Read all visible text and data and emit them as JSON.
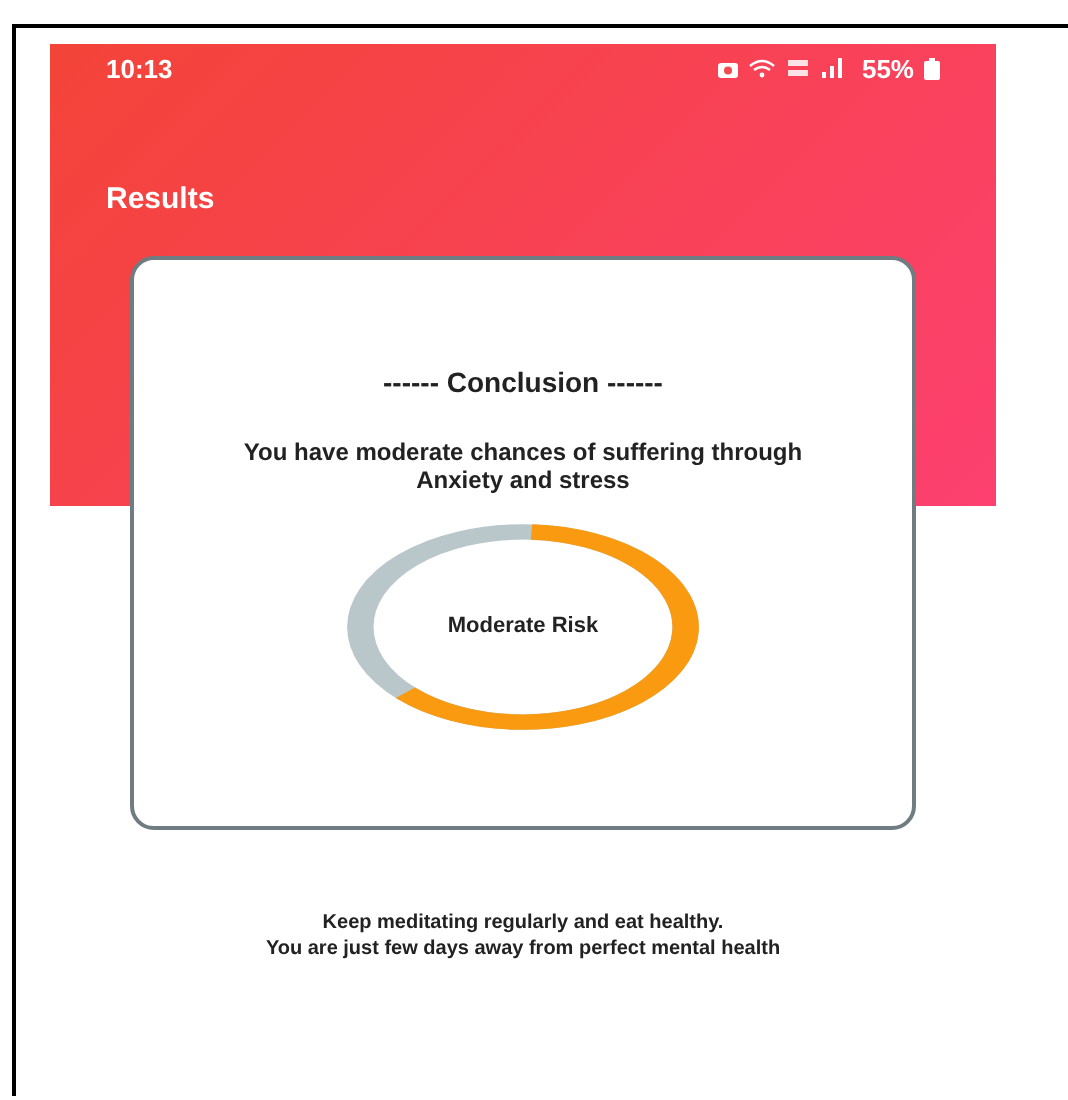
{
  "status_bar": {
    "time": "10:13",
    "battery": "55%"
  },
  "header": {
    "title": "Results"
  },
  "card": {
    "heading": "------ Conclusion ------",
    "message": "You have moderate chances of suffering through Anxiety and stress",
    "meter": {
      "level": 0.62,
      "label": "Moderate Risk"
    }
  },
  "advice": [
    "Keep meditating regularly and eat healthy.",
    "You are just few days away from perfect mental health"
  ]
}
